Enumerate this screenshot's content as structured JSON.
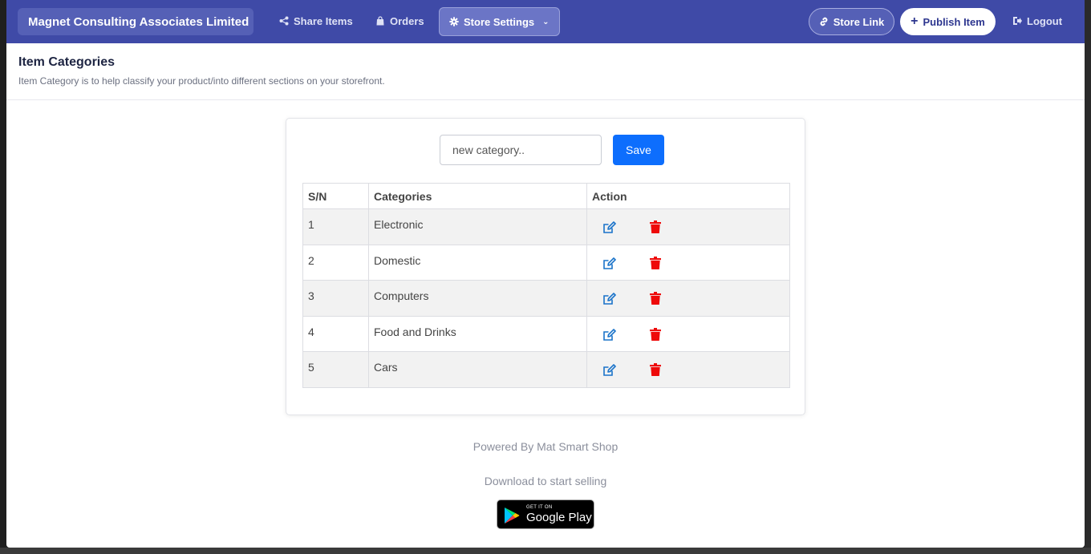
{
  "navbar": {
    "brand": "Magnet Consulting Associates Limited",
    "share_items": "Share Items",
    "orders": "Orders",
    "store_settings": "Store Settings",
    "store_link": "Store Link",
    "publish_item": "Publish Item",
    "logout": "Logout"
  },
  "header": {
    "title": "Item Categories",
    "subtitle": "Item Category is to help classify your product/into different sections on your storefront."
  },
  "form": {
    "placeholder": "new category..",
    "save_label": "Save"
  },
  "table": {
    "headers": [
      "S/N",
      "Categories",
      "Action"
    ],
    "rows": [
      {
        "sn": "1",
        "name": "Electronic"
      },
      {
        "sn": "2",
        "name": "Domestic"
      },
      {
        "sn": "3",
        "name": "Computers"
      },
      {
        "sn": "4",
        "name": "Food and Drinks"
      },
      {
        "sn": "5",
        "name": "Cars"
      }
    ]
  },
  "footer": {
    "powered": "Powered By Mat Smart Shop",
    "download": "Download to start selling",
    "badge_small": "GET IT ON",
    "badge_big": "Google Play"
  },
  "colors": {
    "navbar": "#3f4aa7",
    "save_button": "#0d6efd",
    "edit_icon": "#1a73c9",
    "delete_icon": "#ee0a0a"
  },
  "icons": {
    "share": "share-icon",
    "orders": "shopping-bag-icon",
    "settings": "gear-icon",
    "store_link": "link-icon",
    "publish": "plus-icon",
    "logout": "logout-icon",
    "edit": "edit-icon",
    "delete": "trash-icon"
  }
}
